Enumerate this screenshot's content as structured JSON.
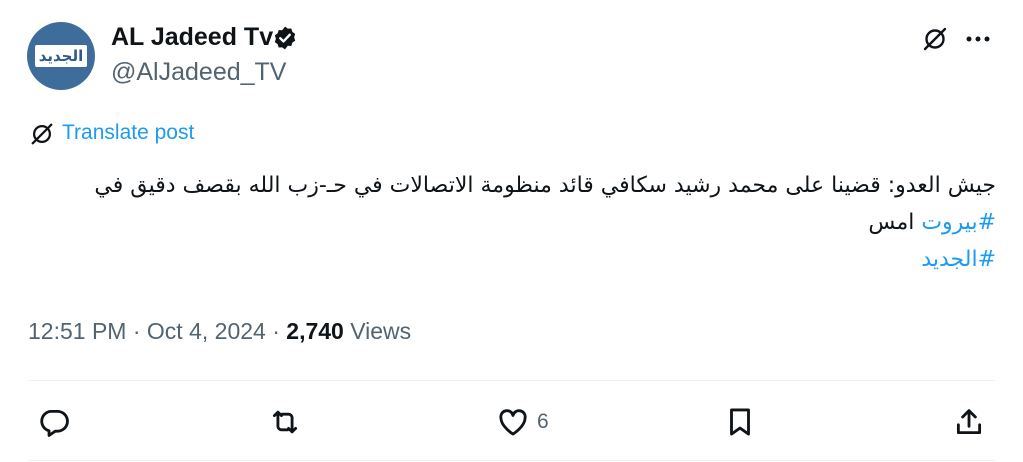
{
  "author": {
    "display_name": "AL Jadeed Tv",
    "handle": "@AlJadeed_TV",
    "avatar_text": "الجديد",
    "verified": true
  },
  "translate_label": "Translate post",
  "post": {
    "line1": "جيش العدو: قضينا على محمد رشيد سكافي قائد منظومة الاتصالات في حـ-زب الله بقصف دقيق في",
    "hashtag1": "#بيروت",
    "line2_rest": " امس",
    "hashtag2": "#الجديد"
  },
  "meta": {
    "time": "12:51 PM",
    "separator1": " · ",
    "date": "Oct 4, 2024",
    "separator2": " · ",
    "views_count": "2,740",
    "views_label": " Views"
  },
  "actions": {
    "likes_count": "6"
  },
  "colors": {
    "accent": "#1d9bf0",
    "text": "#0f1419",
    "secondary": "#536471",
    "avatar_bg": "#3e6d9c"
  },
  "icons": [
    "verified-badge-icon",
    "grok-icon",
    "more-icon",
    "translate-icon",
    "reply-icon",
    "repost-icon",
    "like-icon",
    "bookmark-icon",
    "share-icon"
  ]
}
